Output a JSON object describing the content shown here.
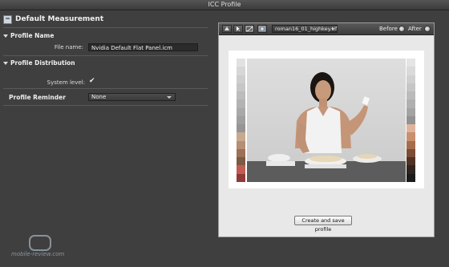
{
  "window": {
    "title": "ICC Profile"
  },
  "header": {
    "title": "Default Measurement"
  },
  "profile_name": {
    "section_label": "Profile Name",
    "file_name_label": "File name:",
    "file_name_value": "Nvidia Default Flat Panel.icm"
  },
  "profile_distribution": {
    "section_label": "Profile Distribution",
    "system_level_label": "System level:",
    "system_level_checked": true,
    "check_glyph": "✔"
  },
  "profile_reminder": {
    "label": "Profile Reminder",
    "selected": "None"
  },
  "preview": {
    "image_selector": "roman16_01_highkey.tif",
    "before_label": "Before",
    "after_label": "After",
    "selected_mode": "After",
    "create_button": "Create and save profile"
  },
  "watermark": {
    "text": "mobile-review.com"
  },
  "colors": {
    "left_strip": [
      "#e2e2e2",
      "#d7d7d7",
      "#cecece",
      "#c6c6c6",
      "#bcbcbc",
      "#b3b3b3",
      "#a9a9a9",
      "#9f9f9f",
      "#959595",
      "#c7a98f",
      "#b58f73",
      "#9c7157",
      "#7d5a45",
      "#c25c52",
      "#8e3b38"
    ],
    "right_strip": [
      "#e5e5e5",
      "#dadada",
      "#d0d0d0",
      "#c6c6c6",
      "#bbbbbb",
      "#b0b0b0",
      "#a3a3a3",
      "#929292",
      "#e0b49c",
      "#c9906e",
      "#a66d4c",
      "#7c4d34",
      "#503225",
      "#2f2420",
      "#1b1b1b"
    ]
  }
}
